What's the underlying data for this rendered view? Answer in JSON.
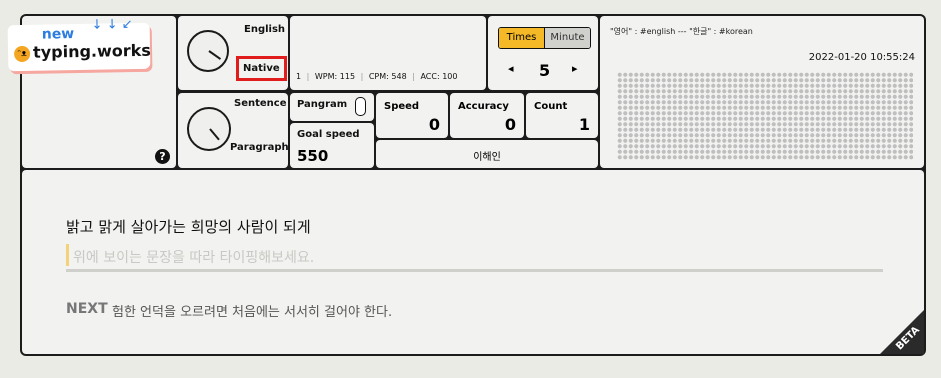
{
  "logo": {
    "new": "new",
    "brand": "typing.works"
  },
  "language": {
    "english": "English",
    "native": "Native",
    "sentence": "Sentence",
    "paragraph": "Paragraph"
  },
  "stats_line": {
    "count": "1",
    "wpm": "WPM: 115",
    "cpm": "CPM: 548",
    "acc": "ACC: 100"
  },
  "mode": {
    "times": "Times",
    "minute": "Minute",
    "value": "5",
    "left": "◂",
    "right": "▸"
  },
  "hint": "\"영어\" : #english --- \"한글\" : #korean",
  "datetime": "2022-01-20 10:55:24",
  "pangram": {
    "label": "Pangram"
  },
  "goal": {
    "label": "Goal speed",
    "value": "550"
  },
  "speed": {
    "label": "Speed",
    "value": "0"
  },
  "accuracy": {
    "label": "Accuracy",
    "value": "0"
  },
  "count": {
    "label": "Count",
    "value": "1"
  },
  "username": "이해인",
  "help": "?",
  "typing": {
    "target": "밝고 맑게 살아가는 희망의 사람이 되게",
    "placeholder": "위에 보이는 문장을 따라 타이핑해보세요.",
    "next_label": "NEXT",
    "next_text": "험한 언덕을 오르려면 처음에는 서서히 걸어야 한다."
  },
  "beta": "BETA",
  "colors": {
    "accent": "#f5b826",
    "highlight_border": "#e01c1c"
  }
}
